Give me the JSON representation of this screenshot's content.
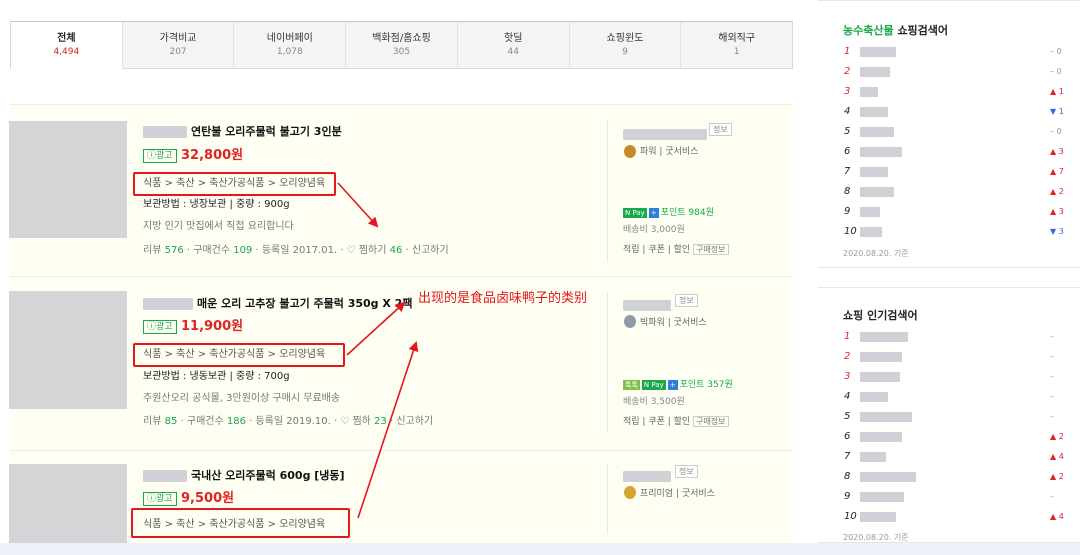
{
  "tabs": [
    {
      "label": "전체",
      "count": "4,494",
      "active": true
    },
    {
      "label": "가격비교",
      "count": "207"
    },
    {
      "label": "네이버페이",
      "count": "1,078"
    },
    {
      "label": "백화점/홈쇼핑",
      "count": "305"
    },
    {
      "label": "핫딜",
      "count": "44"
    },
    {
      "label": "쇼핑윈도",
      "count": "9"
    },
    {
      "label": "해외직구",
      "count": "1"
    }
  ],
  "products": [
    {
      "title": "연탄불 오리주물럭 불고기 3인분",
      "ad_label": "ⓘ광고",
      "price": "32,800원",
      "category": "식품 > 축산 > 축산가공식품 > 오리양념육",
      "spec": "보관방법 : 냉장보관 | 중량 : 900g",
      "desc": "지방 인기 맛집에서 직접 요리합니다",
      "meta_a": "리뷰 ",
      "reviews": "576",
      "meta_b": " · 구매건수 ",
      "purchases": "109",
      "meta_c": " · 등록일 2017.01. · ♡ 찜하기 ",
      "likes": "46",
      "meta_d": " · 신고하기",
      "info_btn": "정보",
      "grade": "파워 | 굿서비스",
      "npay_text": "포인트 984원",
      "shipping": "배송비 3,000원",
      "links": "적립 | 쿠폰 | 할인",
      "links_box": "구매정보"
    },
    {
      "title": "매운 오리 고추장 불고기 주물럭 350g X 2팩",
      "ad_label": "ⓘ광고",
      "price": "11,900원",
      "category": "식품 > 축산 > 축산가공식품 > 오리양념육",
      "spec": "보관방법 : 냉동보관 | 중량 : 700g",
      "desc": "주원산오리 공식몰, 3만원이상 구매시 무료배송",
      "meta_a": "리뷰 ",
      "reviews": "85",
      "meta_b": " · 구매건수 ",
      "purchases": "186",
      "meta_c": " · 등록일 2019.10. · ♡ 찜하 ",
      "likes": "23",
      "meta_d": " · 신고하기",
      "info_btn": "정보",
      "grade": "빅파워 | 굿서비스",
      "npay_text": "포인트 357원",
      "shipping": "배송비 3,500원",
      "links": "적립 | 쿠폰 | 할인",
      "links_box": "구매정보"
    },
    {
      "title": "국내산 오리주물럭 600g [냉동]",
      "ad_label": "ⓘ광고",
      "price": "9,500원",
      "category": "식품 > 축산 > 축산가공식품 > 오리양념육",
      "info_btn": "정보",
      "grade": "프리미엄 | 굿서비스"
    }
  ],
  "annotation": "出现的是食品卤味鸭子的类别",
  "sidebar1": {
    "title_green": "농수축산물",
    "title_rest": " 쇼핑검색어",
    "ranks": [
      {
        "n": "1",
        "trend": "– 0"
      },
      {
        "n": "2",
        "trend": "– 0"
      },
      {
        "n": "3",
        "trend": "▲ 1"
      },
      {
        "n": "4",
        "trend": "▼ 1"
      },
      {
        "n": "5",
        "trend": "– 0"
      },
      {
        "n": "6",
        "trend": "▲ 3"
      },
      {
        "n": "7",
        "trend": "▲ 7"
      },
      {
        "n": "8",
        "trend": "▲ 2"
      },
      {
        "n": "9",
        "trend": "▲ 3"
      },
      {
        "n": "10",
        "trend": "▼ 3"
      }
    ],
    "date": "2020.08.20. 기준"
  },
  "sidebar2": {
    "title": "쇼핑 인기검색어",
    "ranks": [
      {
        "n": "1",
        "trend": "–"
      },
      {
        "n": "2",
        "trend": "–"
      },
      {
        "n": "3",
        "trend": "–"
      },
      {
        "n": "4",
        "trend": "–"
      },
      {
        "n": "5",
        "trend": "–"
      },
      {
        "n": "6",
        "trend": "▲ 2"
      },
      {
        "n": "7",
        "trend": "▲ 4"
      },
      {
        "n": "8",
        "trend": "▲ 2"
      },
      {
        "n": "9",
        "trend": "–"
      },
      {
        "n": "10",
        "trend": "▲ 4"
      }
    ],
    "date": "2020.08.20. 기준"
  },
  "colors": {
    "accent_red": "#e02424",
    "naver_green": "#19a94b",
    "annotation_red": "#e0191d"
  }
}
